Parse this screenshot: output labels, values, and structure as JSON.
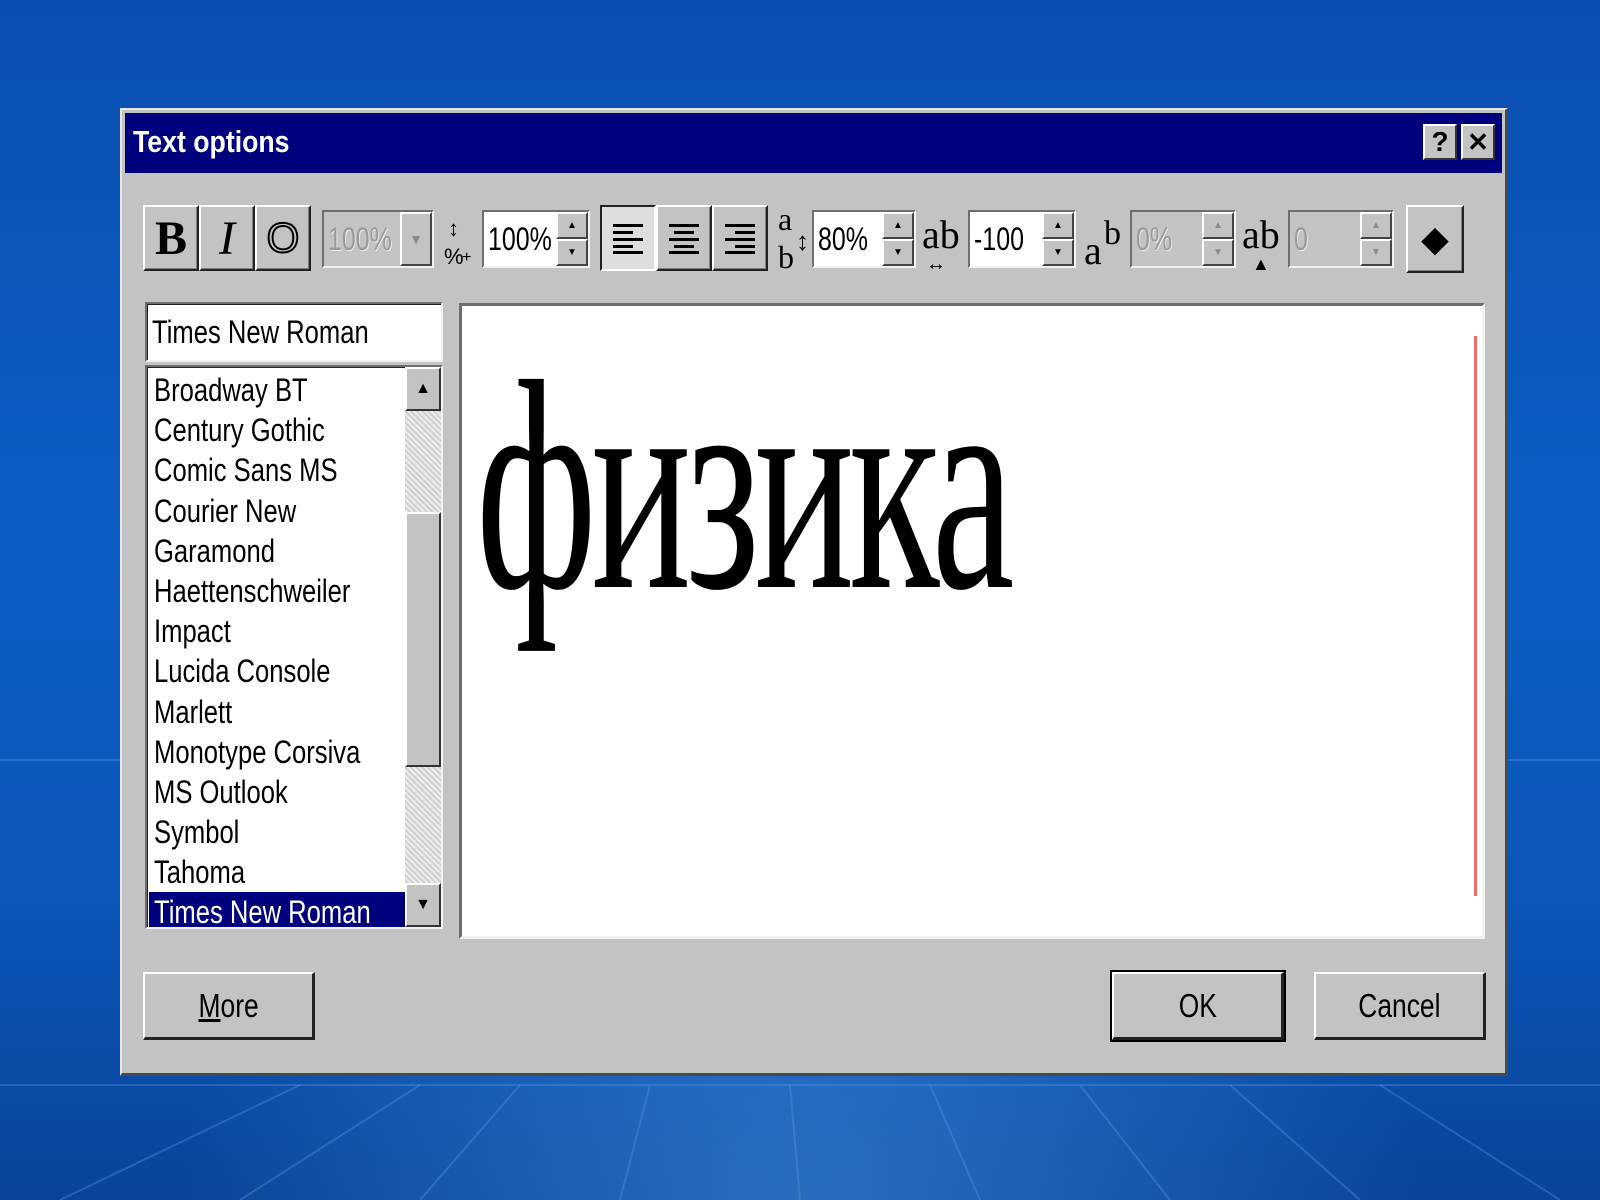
{
  "dialog": {
    "title": "Text options",
    "help_glyph": "?",
    "close_glyph": "✕"
  },
  "toolbar": {
    "bold_label": "B",
    "italic_label": "I",
    "outline_label": "O",
    "width_value": "100%",
    "size_value": "100%",
    "line_spacing_value": "80%",
    "char_spacing_value": "-100",
    "superscript_value": "0%",
    "baseline_value": "0",
    "color_glyph": "◆",
    "disabled_fields": [
      "width",
      "superscript",
      "baseline"
    ],
    "alignment_selected": "left"
  },
  "font_field": {
    "value": "Times New Roman"
  },
  "font_list": {
    "items": [
      "Broadway BT",
      "Century Gothic",
      "Comic Sans MS",
      "Courier New",
      "Garamond",
      "Haettenschweiler",
      "Impact",
      "Lucida Console",
      "Marlett",
      "Monotype Corsiva",
      "MS Outlook",
      "Symbol",
      "Tahoma",
      "Times New Roman"
    ],
    "selected": "Times New Roman"
  },
  "preview": {
    "text": "физика"
  },
  "buttons": {
    "more": "More",
    "ok": "OK",
    "cancel": "Cancel"
  },
  "colors": {
    "titlebar": "#00007f",
    "dialog_face": "#c3c3c3",
    "selection": "#00007f",
    "desktop": "#0b56b8",
    "preview_margin": "#f06a6a"
  }
}
